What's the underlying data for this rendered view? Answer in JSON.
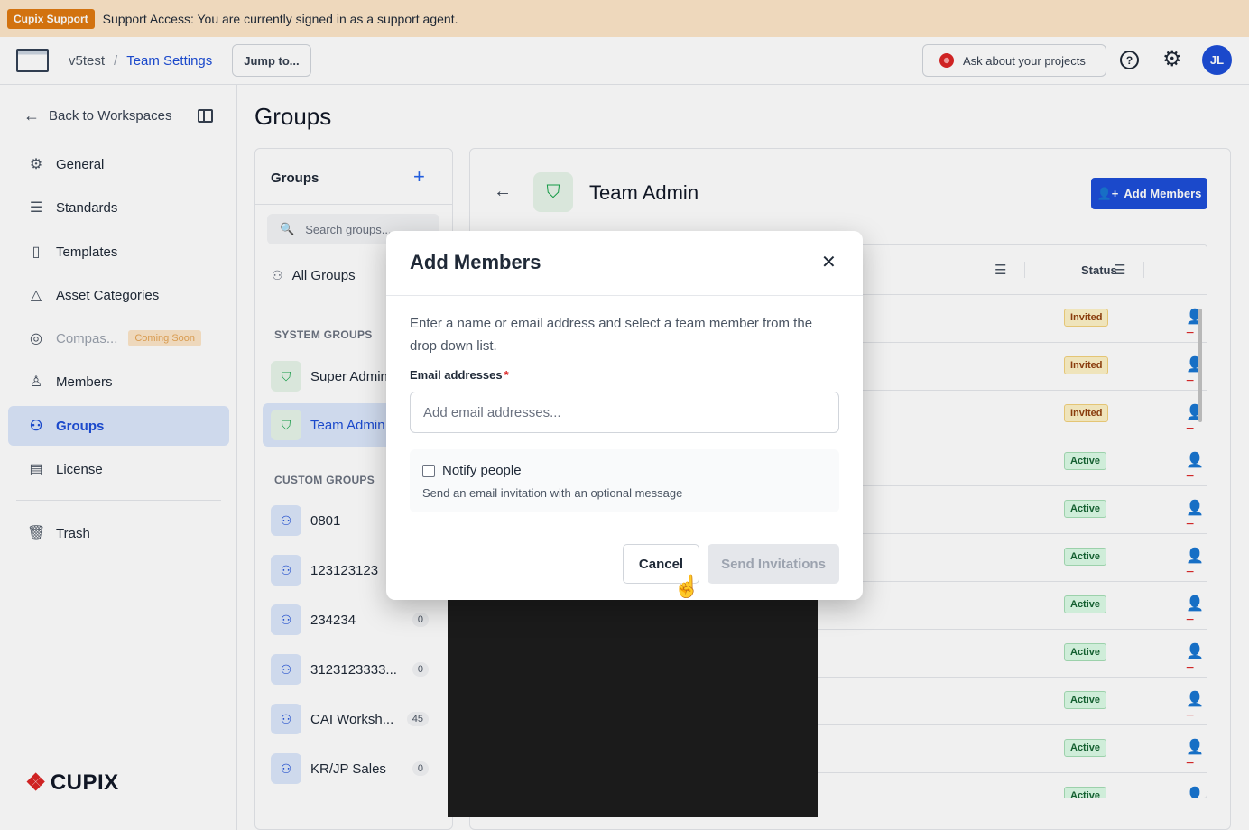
{
  "banner": {
    "tag": "Cupix Support",
    "message": "Support Access: You are currently signed in as a support agent."
  },
  "header": {
    "workspace": "v5test",
    "separator": "/",
    "current": "Team Settings",
    "jump_label": "Jump to...",
    "ask_label": "Ask about your projects",
    "help_glyph": "?",
    "avatar_initials": "JL"
  },
  "sidebar": {
    "back_label": "Back to Workspaces",
    "items": [
      {
        "label": "General",
        "icon": "gear-icon"
      },
      {
        "label": "Standards",
        "icon": "sliders-icon"
      },
      {
        "label": "Templates",
        "icon": "document-icon"
      },
      {
        "label": "Asset Categories",
        "icon": "shapes-icon"
      },
      {
        "label": "Compas...",
        "icon": "compass-icon",
        "badge": "Coming Soon"
      },
      {
        "label": "Members",
        "icon": "person-icon"
      },
      {
        "label": "Groups",
        "icon": "users-icon"
      },
      {
        "label": "License",
        "icon": "license-icon"
      },
      {
        "label": "Trash",
        "icon": "trash-icon"
      }
    ],
    "brand": "CUPIX"
  },
  "main": {
    "page_title": "Groups",
    "groups_panel": {
      "title": "Groups",
      "add_glyph": "+",
      "search_placeholder": "Search groups...",
      "all_groups": "All Groups",
      "system_heading": "SYSTEM GROUPS",
      "system_groups": [
        {
          "name": "Super Admin"
        },
        {
          "name": "Team Admin"
        }
      ],
      "custom_heading": "CUSTOM GROUPS",
      "custom_groups": [
        {
          "name": "0801",
          "count": ""
        },
        {
          "name": "123123123",
          "count": ""
        },
        {
          "name": "234234",
          "count": "0"
        },
        {
          "name": "3123123333...",
          "count": "0"
        },
        {
          "name": "CAI Worksh...",
          "count": "45"
        },
        {
          "name": "KR/JP Sales",
          "count": "0"
        }
      ]
    },
    "detail": {
      "title": "Team Admin",
      "add_members_label": "Add Members",
      "status_header": "Status",
      "rows": [
        {
          "status": "Invited"
        },
        {
          "status": "Invited"
        },
        {
          "status": "Invited"
        },
        {
          "status": "Active"
        },
        {
          "status": "Active"
        },
        {
          "status": "Active"
        },
        {
          "status": "Active"
        },
        {
          "status": "Active"
        },
        {
          "status": "Active"
        },
        {
          "status": "Active"
        },
        {
          "status": "Active"
        }
      ]
    }
  },
  "modal": {
    "title": "Add Members",
    "close_glyph": "✕",
    "description": "Enter a name or email address and select a team member from the drop down list.",
    "email_label": "Email addresses",
    "required_mark": "*",
    "email_placeholder": "Add email addresses...",
    "email_value": "",
    "notify_label": "Notify people",
    "notify_checked": false,
    "notify_sub": "Send an email invitation with an optional message",
    "cancel_label": "Cancel",
    "send_label": "Send Invitations"
  },
  "colors": {
    "accent": "#1d4ed8",
    "banner_bg": "#fde6c8",
    "support_tag": "#e07a10",
    "invited": "#92400e",
    "active": "#166534",
    "danger": "#dc2626"
  }
}
